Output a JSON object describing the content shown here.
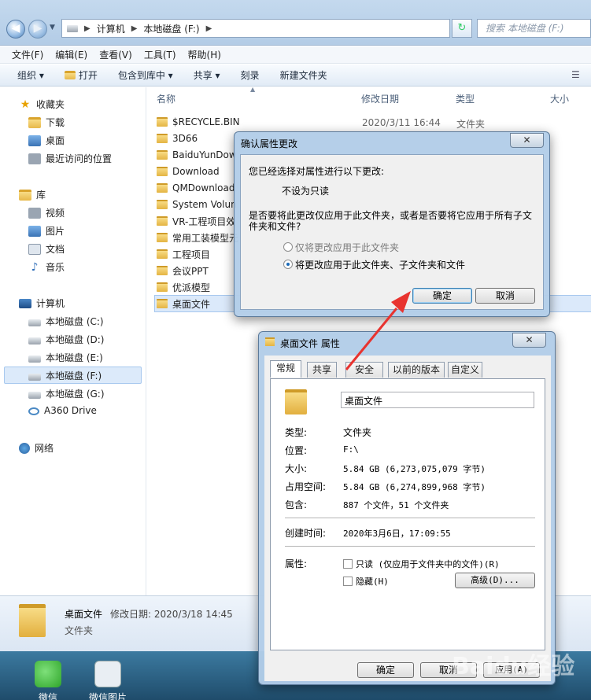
{
  "address": {
    "path": [
      "计算机",
      "本地磁盘 (F:)"
    ],
    "search_placeholder": "搜索 本地磁盘 (F:)"
  },
  "menu": [
    "文件(F)",
    "编辑(E)",
    "查看(V)",
    "工具(T)",
    "帮助(H)"
  ],
  "toolbar": [
    "组织 ▾",
    "打开",
    "包含到库中 ▾",
    "共享 ▾",
    "刻录",
    "新建文件夹"
  ],
  "sidebar": {
    "favorites": {
      "label": "收藏夹",
      "items": [
        "下载",
        "桌面",
        "最近访问的位置"
      ]
    },
    "libraries": {
      "label": "库",
      "items": [
        "视频",
        "图片",
        "文档",
        "音乐"
      ]
    },
    "computer": {
      "label": "计算机",
      "items": [
        "本地磁盘 (C:)",
        "本地磁盘 (D:)",
        "本地磁盘 (E:)",
        "本地磁盘 (F:)",
        "本地磁盘 (G:)",
        "A360 Drive"
      ]
    },
    "network": {
      "label": "网络"
    }
  },
  "columns": [
    "名称",
    "修改日期",
    "类型",
    "大小"
  ],
  "files": [
    {
      "name": "$RECYCLE.BIN",
      "date": "2020/3/11 16:44",
      "type": "文件夹"
    },
    {
      "name": "3D66",
      "date": "",
      "type": ""
    },
    {
      "name": "BaiduYunDow",
      "date": "",
      "type": ""
    },
    {
      "name": "Download",
      "date": "",
      "type": ""
    },
    {
      "name": "QMDownload",
      "date": "",
      "type": ""
    },
    {
      "name": "System Volun",
      "date": "",
      "type": ""
    },
    {
      "name": "VR-工程项目效",
      "date": "",
      "type": ""
    },
    {
      "name": "常用工装模型元",
      "date": "",
      "type": ""
    },
    {
      "name": "工程项目",
      "date": "",
      "type": ""
    },
    {
      "name": "会议PPT",
      "date": "",
      "type": ""
    },
    {
      "name": "优派模型",
      "date": "",
      "type": ""
    },
    {
      "name": "桌面文件",
      "date": "",
      "type": ""
    }
  ],
  "details": {
    "name": "桌面文件",
    "date_label": "修改日期: 2020/3/18 14:45",
    "type": "文件夹"
  },
  "taskbar": [
    "微信",
    "微信图片"
  ],
  "confirm_dialog": {
    "title": "确认属性更改",
    "intro": "您已经选择对属性进行以下更改:",
    "change": "不设为只读",
    "question": "是否要将此更改仅应用于此文件夹，或者是否要将它应用于所有子文件夹和文件?",
    "option1": "仅将更改应用于此文件夹",
    "option2": "将更改应用于此文件夹、子文件夹和文件",
    "ok": "确定",
    "cancel": "取消"
  },
  "props_dialog": {
    "title": "桌面文件 属性",
    "tabs": [
      "常规",
      "共享",
      "安全",
      "以前的版本",
      "自定义"
    ],
    "folder_name": "桌面文件",
    "rows": [
      {
        "label": "类型:",
        "value": "文件夹"
      },
      {
        "label": "位置:",
        "value": "F:\\"
      },
      {
        "label": "大小:",
        "value": "5.84 GB (6,273,075,079 字节)"
      },
      {
        "label": "占用空间:",
        "value": "5.84 GB (6,274,899,968 字节)"
      },
      {
        "label": "包含:",
        "value": "887 个文件，51 个文件夹"
      }
    ],
    "created_label": "创建时间:",
    "created_value": "2020年3月6日，17:09:55",
    "attr_label": "属性:",
    "readonly": "只读 (仅应用于文件夹中的文件)(R)",
    "hidden": "隐藏(H)",
    "advanced": "高级(D)...",
    "ok": "确定",
    "cancel": "取消",
    "apply": "应用(A)"
  },
  "watermark": "Baidu经验",
  "colors": {
    "arrow": "#e8332f",
    "selection": "#dbe9fa"
  }
}
